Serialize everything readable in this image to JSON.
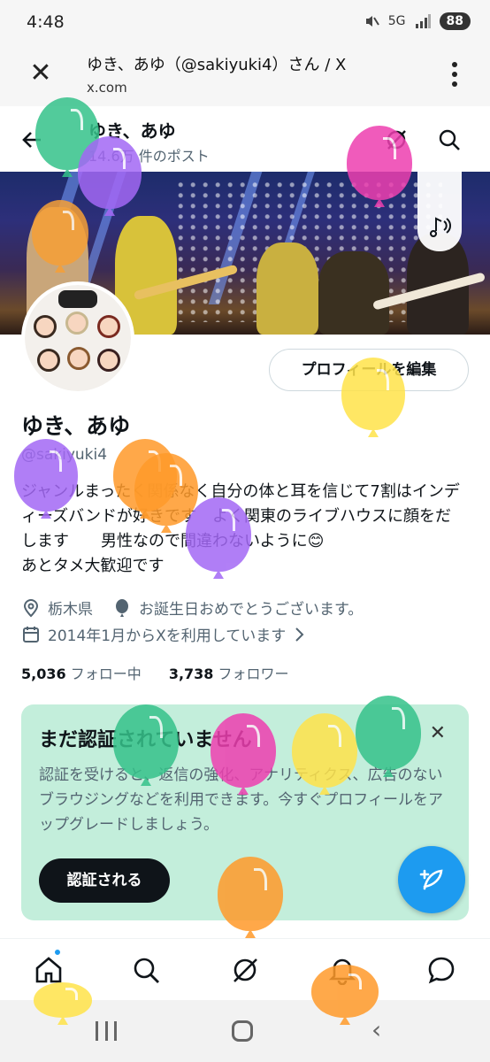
{
  "status_bar": {
    "time": "4:48",
    "signal": "5G",
    "battery": "88"
  },
  "browser": {
    "title": "ゆき、あゆ（@sakiyuki4）さん / X",
    "url": "x.com"
  },
  "profile_header": {
    "name": "ゆき、あゆ",
    "post_count": "14.6万 件のポスト"
  },
  "profile": {
    "edit_button": "プロフィールを編集",
    "display_name": "ゆき、あゆ",
    "handle": "@sakiyuki4",
    "bio": "ジャンルまったく関係なく自分の体と耳を信じて7割はインディーズバンドが好きです　よく関東のライブハウスに顔をだします　　男性なので間違わないように😊\nあとタメ大歓迎です",
    "location": "栃木県",
    "birthday": "お誕生日おめでとうございます。",
    "joined": "2014年1月からXを利用しています",
    "following_count": "5,036",
    "following_label": "フォロー中",
    "followers_count": "3,738",
    "followers_label": "フォロワー"
  },
  "verify_card": {
    "title": "まだ認証されていません",
    "text": "認証を受けると、返信の強化、アナリティクス、広告のないブラウジングなどを利用できます。今すぐプロフィールをアップグレードしましょう。",
    "button": "認証される"
  },
  "icons": [
    "close-icon",
    "menu-icon",
    "back-icon",
    "grok-icon",
    "search-icon",
    "sound-icon",
    "location-icon",
    "balloon-icon",
    "calendar-icon",
    "chevron-right-icon",
    "compose-icon",
    "home-icon",
    "notifications-icon",
    "messages-icon"
  ],
  "colors": {
    "accent": "#1d9bf0",
    "card_bg": "#c3eedb",
    "text": "#0f1419",
    "muted": "#536471"
  }
}
